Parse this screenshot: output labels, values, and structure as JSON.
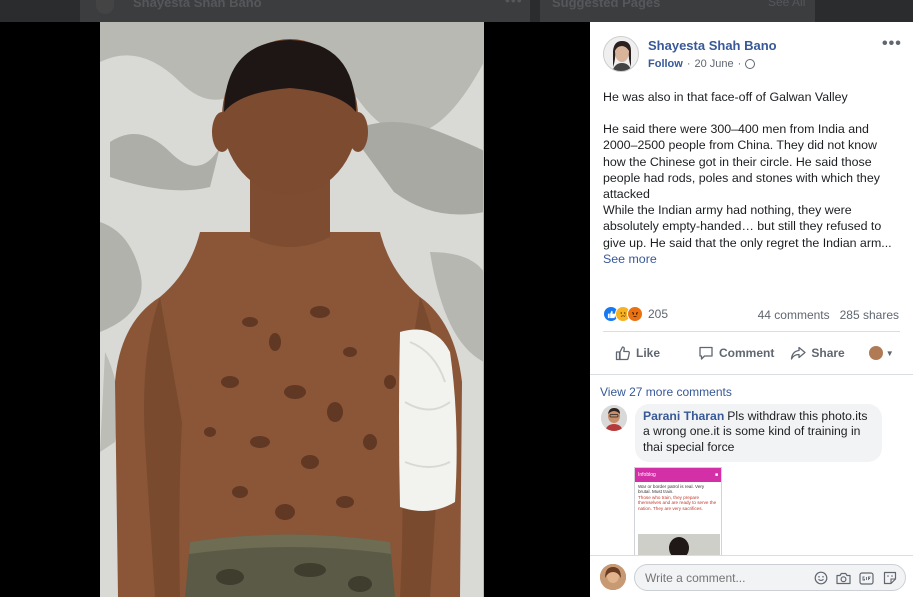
{
  "background_feed": {
    "author": "Shayesta Shah Bano",
    "date_partial": "20 June",
    "sidebar_title": "Suggested Pages",
    "see_all": "See All"
  },
  "post": {
    "author": "Shayesta Shah Bano",
    "follow_label": "Follow",
    "separator": "·",
    "date": "20 June",
    "privacy_icon": "globe-icon",
    "options_icon": "more-options-icon",
    "paragraph_1": "He was also in that face-off of Galwan Valley",
    "paragraph_2": "He said there were 300–400 men from India and 2000–2500 people from China. They did not know how the Chinese got in their circle. He said those people had rods, poles and stones with which they attacked",
    "paragraph_3": "While the Indian army had nothing, they were absolutely empty-handed… but still they refused to give up. He said that the only regret the Indian arm...",
    "see_more": "See more"
  },
  "engagement": {
    "reaction_icons": [
      "like-reaction-icon",
      "sad-reaction-icon",
      "angry-reaction-icon"
    ],
    "reaction_count": "205",
    "comments": "44 comments",
    "shares": "285 shares"
  },
  "actions": {
    "like": "Like",
    "comment": "Comment",
    "share": "Share"
  },
  "comments": {
    "view_more": "View 27 more comments",
    "items": [
      {
        "name": "Parani Tharan",
        "text": "Pls withdraw this photo.its a wrong one.it is some kind of training in thai special force",
        "attachment": {
          "header": "Infoblog",
          "line_1": "War or border patrol is real. Very brutal. Must train.",
          "line_2": "Those who train, they prepare themselves and are ready to serve the nation. They are very sacrifices."
        }
      }
    ]
  },
  "composer": {
    "placeholder": "Write a comment...",
    "icons": [
      "emoji-icon",
      "camera-icon",
      "gif-icon",
      "sticker-icon"
    ]
  },
  "colors": {
    "link": "#385898",
    "like_blue": "#1877f2",
    "sad_yellow": "#f7b125",
    "angry_orange": "#e9710f"
  }
}
